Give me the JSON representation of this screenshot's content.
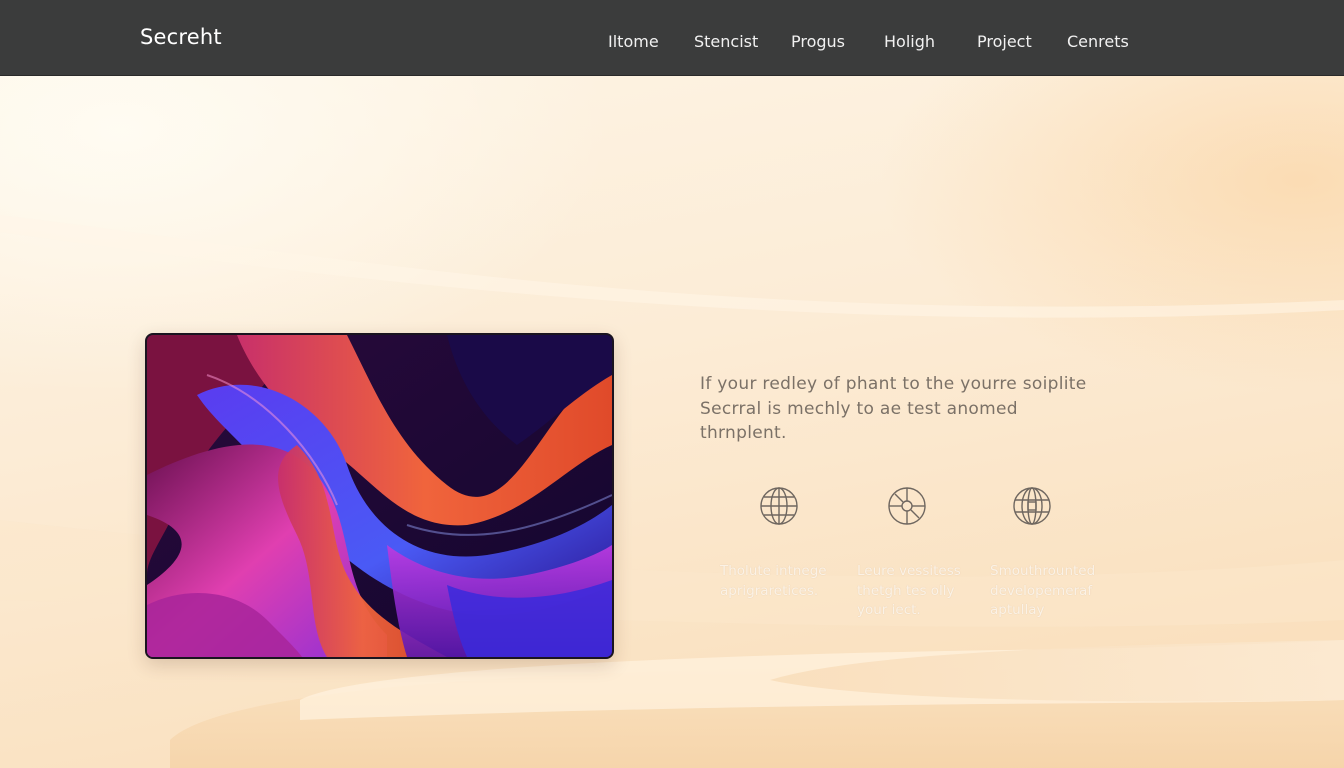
{
  "header": {
    "brand": "Secreht",
    "nav": [
      "Iltome",
      "Stencist",
      "Progus",
      "Holigh",
      "Project",
      "Cenrets"
    ]
  },
  "hero": {
    "intro_lines": [
      "If your redley of phant to the yourre soiplite",
      "Secrral is mechly to ae test anomed",
      "thrnplent."
    ],
    "features": [
      {
        "icon": "globe-icon",
        "lines": [
          "Tholute intnege",
          "aprigraretices."
        ]
      },
      {
        "icon": "compass-icon",
        "lines": [
          "Leure vessitess",
          "thetgh tes olly",
          "your iect."
        ]
      },
      {
        "icon": "sphere-grid-icon",
        "lines": [
          "Smouthrounted",
          "developemeraf",
          "aptullay"
        ]
      }
    ]
  },
  "colors": {
    "navbar": "#3b3c3c",
    "background": "#fcecd6",
    "intro_text": "#7b7167",
    "feature_text": "#fbf2e6",
    "icon_stroke": "#6f6760"
  }
}
